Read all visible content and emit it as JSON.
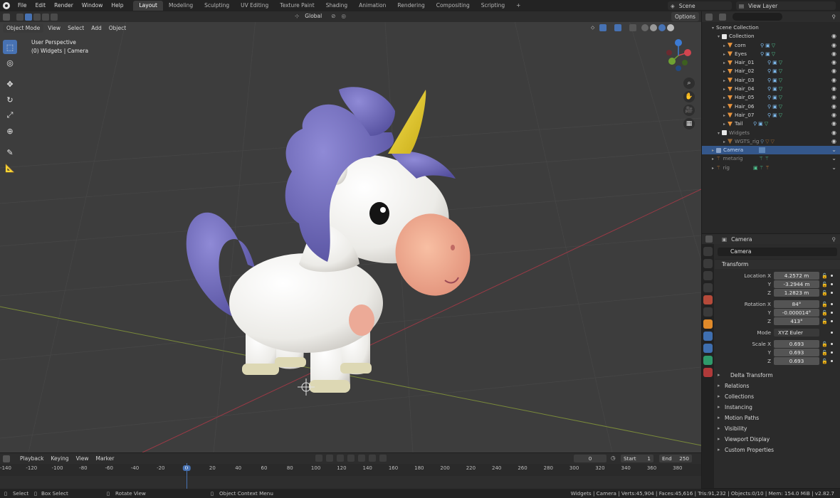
{
  "topbar": {
    "menus": [
      "File",
      "Edit",
      "Render",
      "Window",
      "Help"
    ],
    "workspaces": [
      "Layout",
      "Modeling",
      "Sculpting",
      "UV Editing",
      "Texture Paint",
      "Shading",
      "Animation",
      "Rendering",
      "Compositing",
      "Scripting"
    ],
    "add_tab": "+",
    "scene": "Scene",
    "view_layer": "View Layer"
  },
  "viewport": {
    "mode": "Object Mode",
    "menus": [
      "View",
      "Select",
      "Add",
      "Object"
    ],
    "orientation": "Global",
    "options": "Options",
    "info_line1": "User Perspective",
    "info_line2": "(0) Widgets | Camera"
  },
  "outliner": {
    "rows": [
      {
        "label": "Scene Collection"
      },
      {
        "label": "Collection"
      },
      {
        "label": "corn"
      },
      {
        "label": "Eyes"
      },
      {
        "label": "Hair_01"
      },
      {
        "label": "Hair_02"
      },
      {
        "label": "Hair_03"
      },
      {
        "label": "Hair_04"
      },
      {
        "label": "Hair_05"
      },
      {
        "label": "Hair_06"
      },
      {
        "label": "Hair_07"
      },
      {
        "label": "Tail"
      },
      {
        "label": "Widgets"
      },
      {
        "label": "WGTS_rig"
      },
      {
        "label": "Camera"
      },
      {
        "label": "metarig"
      },
      {
        "label": "rig"
      }
    ]
  },
  "properties": {
    "header": "Camera",
    "object_name": "Camera",
    "transform_label": "Transform",
    "location_x_label": "Location X",
    "location_x": "4.2572 m",
    "location_y_label": "Y",
    "location_y": "-3.2944 m",
    "location_z_label": "Z",
    "location_z": "1.2823 m",
    "rotation_x_label": "Rotation X",
    "rotation_x": "84°",
    "rotation_y_label": "Y",
    "rotation_y": "-0.000014°",
    "rotation_z_label": "Z",
    "rotation_z": "413°",
    "mode_label": "Mode",
    "mode": "XYZ Euler",
    "scale_x_label": "Scale X",
    "scale_x": "0.693",
    "scale_y_label": "Y",
    "scale_y": "0.693",
    "scale_z_label": "Z",
    "scale_z": "0.693",
    "delta_transform": "Delta Transform",
    "sections": [
      "Relations",
      "Collections",
      "Instancing",
      "Motion Paths",
      "Visibility",
      "Viewport Display",
      "Custom Properties"
    ]
  },
  "timeline": {
    "menus": [
      "Playback",
      "Keying",
      "View",
      "Marker"
    ],
    "current_frame": "0",
    "start_label": "Start",
    "start": "1",
    "end_label": "End",
    "end": "250",
    "ticks": [
      "-140",
      "-120",
      "-100",
      "-80",
      "-60",
      "-40",
      "-20",
      "0",
      "20",
      "40",
      "60",
      "80",
      "100",
      "120",
      "140",
      "160",
      "180",
      "200",
      "220",
      "240",
      "260",
      "280",
      "300",
      "320",
      "340",
      "360",
      "380"
    ]
  },
  "statusbar": {
    "select": "Select",
    "box_select": "Box Select",
    "rotate_view": "Rotate View",
    "context_menu": "Object Context Menu",
    "stats": "Widgets | Camera | Verts:45,904 | Faces:45,616 | Tris:91,232 | Objects:0/10 | Mem: 154.0 MiB | v2.82.7"
  },
  "colors": {
    "accent": "#4772b3",
    "viewport_bg": "#3d3d3d",
    "unicorn_body": "#f2f0ec",
    "unicorn_mane": "#6f6bb8",
    "unicorn_horn": "#e3c92f",
    "unicorn_snout": "#f0a98d"
  }
}
